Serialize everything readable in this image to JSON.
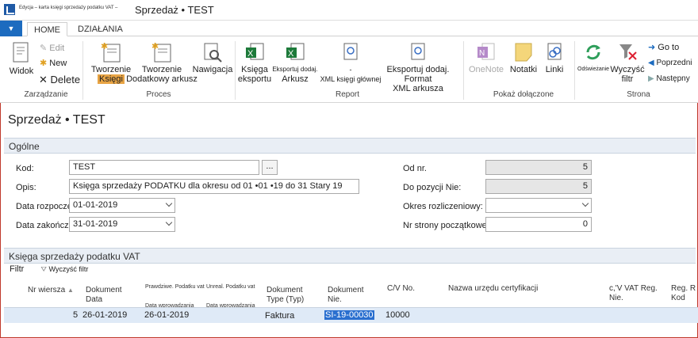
{
  "window": {
    "small_text": "Edycja – karta księgi sprzedaży podatku VAT –",
    "title": "Sprzedaż • TEST"
  },
  "tabs": {
    "file": "▼",
    "home": "HOME",
    "actions": "DZIAŁANIA"
  },
  "ribbon": {
    "manage": {
      "view": "Widok",
      "edit": "Edit",
      "new": "New",
      "delete": "Delete",
      "group": "Zarządzanie"
    },
    "process": {
      "create_book_1": "Tworzenie",
      "create_book_2": "Księgi",
      "create_extra_1": "Tworzenie",
      "create_extra_2": "Dodatkowy arkusz",
      "navigate": "Nawigacja",
      "group": "Proces"
    },
    "report": {
      "export_book_1": "Księga",
      "export_book_2": "eksportu",
      "export_add_1": "Eksportuj dodaj.",
      "export_add_2": "Arkusz",
      "xml_main_1": "-",
      "xml_main_2": "XML księgi głównej",
      "export_format_1": "Eksportuj dodaj. Format",
      "export_format_2": "XML arkusza",
      "group": "Report"
    },
    "attached": {
      "onenote": "OneNote",
      "notes": "Notatki",
      "links": "Linki",
      "group": "Pokaż dołączone"
    },
    "page": {
      "refresh": "Odświeżanie",
      "clear_filter_1": "Wyczyść",
      "clear_filter_2": "filtr",
      "goto": "Go to",
      "previous": "Poprzedni",
      "next": "Następny",
      "group": "Strona"
    }
  },
  "page_title": "Sprzedaż • TEST",
  "general": {
    "header": "Ogólne",
    "code_label": "Kod:",
    "code_value": "TEST",
    "ellipsis": "...",
    "desc_label": "Opis:",
    "desc_value": "Księga sprzedaży PODATKU dla okresu od 01 •01 •19 do 31 Stary 19",
    "start_label": "Data rozpoczęcia:",
    "start_value": "01-01-2019",
    "end_label": "Data zakończenia:",
    "end_value": "31-01-2019",
    "from_no_label": "Od nr.",
    "from_no_value": "5",
    "to_no_label": "Do pozycji Nie:",
    "to_no_value": "5",
    "period_label": "Okres rozliczeniowy:",
    "period_value": "",
    "start_page_label": "Nr strony początkowej:",
    "start_page_value": "0"
  },
  "ledger": {
    "header": "Księga sprzedaży podatku VAT",
    "filter": "Filtr",
    "clear_filter": "Wyczyść filtr",
    "columns": {
      "line_no": "Nr wiersza",
      "doc_date_1": "Dokument",
      "doc_date_2": "Data",
      "real_vat_1": "Prawdziwe. Podatku vat",
      "real_vat_2": "Data wprowadzania",
      "unreal_vat_1": "Unreal. Podatku vat",
      "unreal_vat_2": "Data wprowadzania",
      "doc_type_1": "Dokument",
      "doc_type_2": "Type (Typ)",
      "doc_no_1": "Dokument",
      "doc_no_2": "Nie.",
      "cv_no": "C/V No.",
      "cert_office": "Nazwa urzędu certyfikacji",
      "vat_reg_1": "c,'V VAT Reg.",
      "vat_reg_2": "Nie.",
      "reg_code_1": "Reg. R",
      "reg_code_2": "Kod"
    },
    "rows": [
      {
        "line_no": "5",
        "doc_date": "26-01-2019",
        "real_vat_date": "26-01-2019",
        "doc_type": "Faktura",
        "doc_no": "SI-19-00030",
        "cv_no": "10000"
      }
    ]
  }
}
